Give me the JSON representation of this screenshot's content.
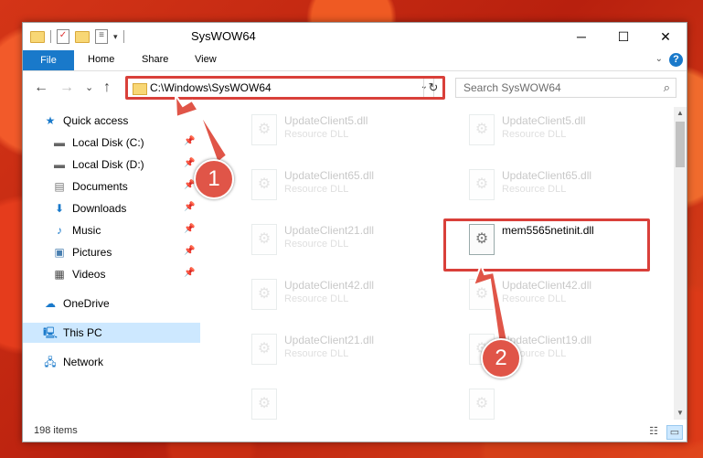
{
  "window": {
    "title": "SysWOW64",
    "minimize": "─",
    "maximize": "☐",
    "close": "✕"
  },
  "qat": {
    "more": "▾"
  },
  "ribbon": {
    "file_tab": "File",
    "tabs": [
      "Home",
      "Share",
      "View"
    ],
    "expand": "⌄",
    "help": "?"
  },
  "navigation": {
    "back": "←",
    "forward": "→",
    "recent": "⌄",
    "up": "↑",
    "address": "C:\\Windows\\SysWOW64",
    "address_dropdown": "⌄",
    "refresh": "↻",
    "search_placeholder": "Search SysWOW64",
    "search_icon": "⌕"
  },
  "sidebar": {
    "quick_access": "Quick access",
    "items": [
      {
        "label": "Local Disk (C:)",
        "icon": "drive-icon"
      },
      {
        "label": "Local Disk (D:)",
        "icon": "drive-icon"
      },
      {
        "label": "Documents",
        "icon": "documents-icon"
      },
      {
        "label": "Downloads",
        "icon": "downloads-icon"
      },
      {
        "label": "Music",
        "icon": "music-icon"
      },
      {
        "label": "Pictures",
        "icon": "pictures-icon"
      },
      {
        "label": "Videos",
        "icon": "videos-icon"
      }
    ],
    "onedrive": "OneDrive",
    "this_pc": "This PC",
    "network": "Network"
  },
  "files": [
    {
      "name": "UpdateClient5.dll",
      "type": "Resource DLL"
    },
    {
      "name": "UpdateClient5.dll",
      "type": "Resource DLL"
    },
    {
      "name": "UpdateClient65.dll",
      "type": "Resource DLL"
    },
    {
      "name": "UpdateClient65.dll",
      "type": "Resource DLL"
    },
    {
      "name": "UpdateClient21.dll",
      "type": "Resource DLL"
    },
    {
      "name": "mem5565netinit.dll",
      "type": ""
    },
    {
      "name": "UpdateClient42.dll",
      "type": "Resource DLL"
    },
    {
      "name": "UpdateClient42.dll",
      "type": "Resource DLL"
    },
    {
      "name": "UpdateClient21.dll",
      "type": "Resource DLL"
    },
    {
      "name": "UpdateClient19.dll",
      "type": "Resource DLL"
    }
  ],
  "annotations": {
    "step1": "1",
    "step2": "2",
    "highlight_color": "#d9403a"
  },
  "status": {
    "item_count": "198 items"
  },
  "colors": {
    "accent": "#1979ca",
    "selected_nav": "#cde8ff"
  }
}
